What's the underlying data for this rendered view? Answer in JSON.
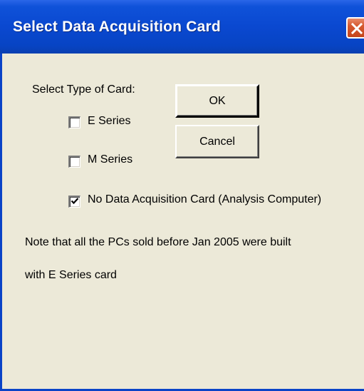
{
  "window": {
    "title": "Select Data Acquisition Card"
  },
  "card_type": {
    "label": "Select Type of Card:",
    "options": [
      {
        "label": "E Series",
        "checked": false
      },
      {
        "label": "M Series",
        "checked": false
      },
      {
        "label": "No Data Acquisition Card (Analysis Computer)",
        "checked": true
      }
    ]
  },
  "buttons": {
    "ok_label": "OK",
    "cancel_label": "Cancel"
  },
  "note": {
    "line1": "Note that all the PCs sold before Jan 2005 were built",
    "line2": "with E Series card"
  },
  "icons": {
    "close": "close-icon",
    "check": "checkmark-icon"
  },
  "colors": {
    "titlebar": "#0a48d0",
    "dialog_background": "#ece9d8",
    "close_button": "#d5582f"
  }
}
